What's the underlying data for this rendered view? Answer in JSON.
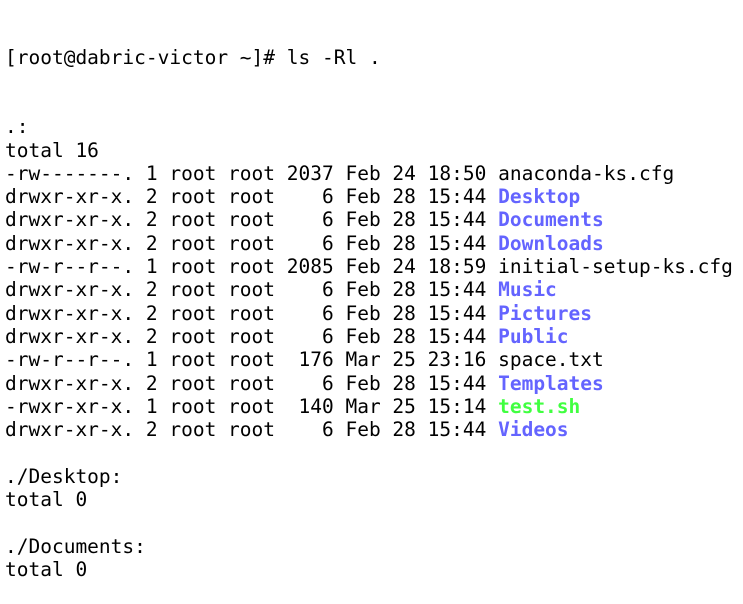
{
  "terminal": {
    "prompt": "[root@dabric-victor ~]# ",
    "command": "ls -Rl .",
    "colors": {
      "directory": "#6464ff",
      "executable": "#40ff40",
      "text": "#000000",
      "background": "#ffffff"
    },
    "sections": [
      {
        "header": ".:",
        "total": "total 16",
        "entries": [
          {
            "perms": "-rw-------.",
            "links": "1",
            "owner": "root",
            "group": "root",
            "size": "2037",
            "month": "Feb",
            "day": "24",
            "time": "18:50",
            "name": "anaconda-ks.cfg",
            "type": "file"
          },
          {
            "perms": "drwxr-xr-x.",
            "links": "2",
            "owner": "root",
            "group": "root",
            "size": "6",
            "month": "Feb",
            "day": "28",
            "time": "15:44",
            "name": "Desktop",
            "type": "dir"
          },
          {
            "perms": "drwxr-xr-x.",
            "links": "2",
            "owner": "root",
            "group": "root",
            "size": "6",
            "month": "Feb",
            "day": "28",
            "time": "15:44",
            "name": "Documents",
            "type": "dir"
          },
          {
            "perms": "drwxr-xr-x.",
            "links": "2",
            "owner": "root",
            "group": "root",
            "size": "6",
            "month": "Feb",
            "day": "28",
            "time": "15:44",
            "name": "Downloads",
            "type": "dir"
          },
          {
            "perms": "-rw-r--r--.",
            "links": "1",
            "owner": "root",
            "group": "root",
            "size": "2085",
            "month": "Feb",
            "day": "24",
            "time": "18:59",
            "name": "initial-setup-ks.cfg",
            "type": "file"
          },
          {
            "perms": "drwxr-xr-x.",
            "links": "2",
            "owner": "root",
            "group": "root",
            "size": "6",
            "month": "Feb",
            "day": "28",
            "time": "15:44",
            "name": "Music",
            "type": "dir"
          },
          {
            "perms": "drwxr-xr-x.",
            "links": "2",
            "owner": "root",
            "group": "root",
            "size": "6",
            "month": "Feb",
            "day": "28",
            "time": "15:44",
            "name": "Pictures",
            "type": "dir"
          },
          {
            "perms": "drwxr-xr-x.",
            "links": "2",
            "owner": "root",
            "group": "root",
            "size": "6",
            "month": "Feb",
            "day": "28",
            "time": "15:44",
            "name": "Public",
            "type": "dir"
          },
          {
            "perms": "-rw-r--r--.",
            "links": "1",
            "owner": "root",
            "group": "root",
            "size": "176",
            "month": "Mar",
            "day": "25",
            "time": "23:16",
            "name": "space.txt",
            "type": "file"
          },
          {
            "perms": "drwxr-xr-x.",
            "links": "2",
            "owner": "root",
            "group": "root",
            "size": "6",
            "month": "Feb",
            "day": "28",
            "time": "15:44",
            "name": "Templates",
            "type": "dir"
          },
          {
            "perms": "-rwxr-xr-x.",
            "links": "1",
            "owner": "root",
            "group": "root",
            "size": "140",
            "month": "Mar",
            "day": "25",
            "time": "15:14",
            "name": "test.sh",
            "type": "exec"
          },
          {
            "perms": "drwxr-xr-x.",
            "links": "2",
            "owner": "root",
            "group": "root",
            "size": "6",
            "month": "Feb",
            "day": "28",
            "time": "15:44",
            "name": "Videos",
            "type": "dir"
          }
        ]
      },
      {
        "header": "./Desktop:",
        "total": "total 0",
        "entries": []
      },
      {
        "header": "./Documents:",
        "total": "total 0",
        "entries": []
      }
    ]
  }
}
